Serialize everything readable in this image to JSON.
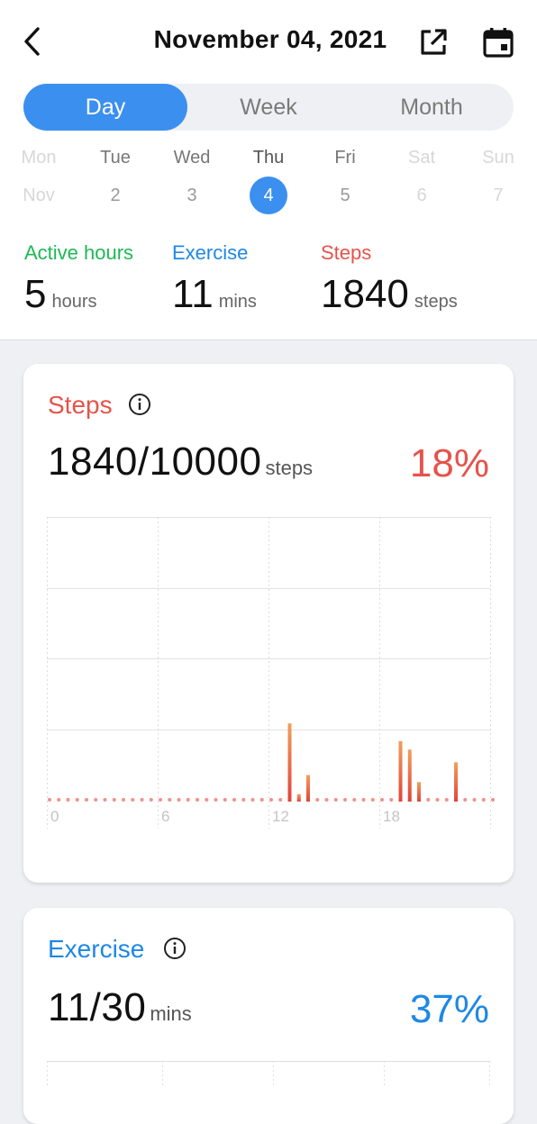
{
  "header": {
    "title": "November 04, 2021"
  },
  "tabs": [
    {
      "label": "Day",
      "active": true
    },
    {
      "label": "Week",
      "active": false
    },
    {
      "label": "Month",
      "active": false
    }
  ],
  "week": [
    {
      "name": "Mon",
      "num": "Nov",
      "state": "faded"
    },
    {
      "name": "Tue",
      "num": "2",
      "state": "normal"
    },
    {
      "name": "Wed",
      "num": "3",
      "state": "normal"
    },
    {
      "name": "Thu",
      "num": "4",
      "state": "selected"
    },
    {
      "name": "Fri",
      "num": "5",
      "state": "normal"
    },
    {
      "name": "Sat",
      "num": "6",
      "state": "faded"
    },
    {
      "name": "Sun",
      "num": "7",
      "state": "faded"
    }
  ],
  "summary": {
    "active": {
      "label": "Active hours",
      "value": "5",
      "unit": "hours",
      "color": "#1db954"
    },
    "exercise": {
      "label": "Exercise",
      "value": "11",
      "unit": "mins",
      "color": "#1e88e5"
    },
    "steps": {
      "label": "Steps",
      "value": "1840",
      "unit": "steps",
      "color": "#e5534b"
    }
  },
  "steps_card": {
    "title": "Steps",
    "value": "1840/10000",
    "unit": "steps",
    "percent": "18%",
    "color": "#e5534b"
  },
  "exercise_card": {
    "title": "Exercise",
    "value": "11/30",
    "unit": "mins",
    "percent": "37%",
    "color": "#1e88e5"
  },
  "chart_data": {
    "type": "bar",
    "x_ticks": [
      "0",
      "6",
      "12",
      "18"
    ],
    "x_range": [
      0,
      24
    ],
    "ylim": [
      0,
      4
    ],
    "grid": true,
    "bar_color_top": "#f0a05a",
    "bar_color_bottom": "#e0443c",
    "series": [
      {
        "x": [
          13.0,
          13.5,
          14.0,
          19.0,
          19.5,
          20.0,
          22.0
        ],
        "values": [
          1.08,
          0.08,
          0.35,
          0.83,
          0.71,
          0.25,
          0.53
        ]
      }
    ]
  }
}
